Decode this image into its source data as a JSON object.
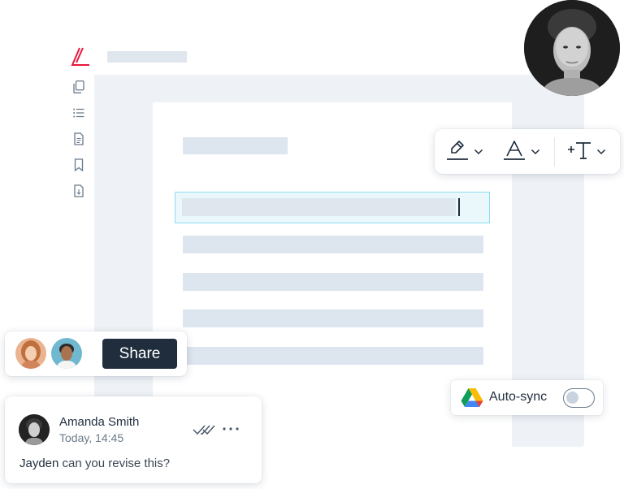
{
  "colors": {
    "accent": "#e8183d",
    "ink": "#1f2d3d",
    "muted": "#6b7b8c",
    "placeholder": "#dde5ee",
    "canvas": "#eef2f6",
    "selection": "#eaf8fc",
    "selection_border": "#8fdbee"
  },
  "app": {
    "logo_icon": "pdf-editor-logo-icon"
  },
  "sidebar": {
    "items": [
      {
        "icon": "pages-icon"
      },
      {
        "icon": "outline-list-icon"
      },
      {
        "icon": "document-icon"
      },
      {
        "icon": "bookmark-icon"
      },
      {
        "icon": "attachment-file-icon"
      }
    ]
  },
  "toolbar": {
    "items": [
      {
        "icon": "highlighter-icon",
        "has_dropdown": true
      },
      {
        "icon": "text-color-icon",
        "has_dropdown": true
      },
      {
        "icon": "add-text-icon",
        "has_dropdown": true
      }
    ]
  },
  "share": {
    "button_label": "Share",
    "collaborators": [
      {
        "icon": "collaborator-avatar"
      },
      {
        "icon": "collaborator-avatar"
      }
    ]
  },
  "comment": {
    "author": "Amanda Smith",
    "time": "Today, 14:45",
    "mention": "Jayden",
    "text": " can you revise this?",
    "read_icon": "double-check-icon",
    "more_icon": "more-horizontal-icon"
  },
  "sync": {
    "label": "Auto-sync",
    "icon": "google-drive-icon",
    "enabled": false
  }
}
